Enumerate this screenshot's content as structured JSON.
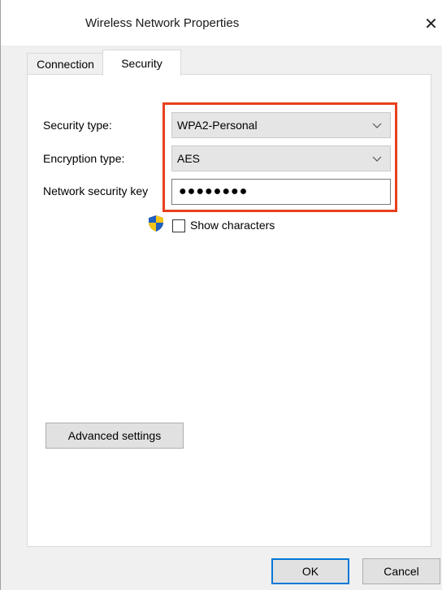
{
  "window": {
    "title": "Wireless Network Properties",
    "close_glyph": "✕"
  },
  "tabs": [
    {
      "label": "Connection",
      "selected": false
    },
    {
      "label": "Security",
      "selected": true
    }
  ],
  "security": {
    "security_type_label": "Security type:",
    "security_type_value": "WPA2-Personal",
    "encryption_type_label": "Encryption type:",
    "encryption_type_value": "AES",
    "key_label": "Network security key",
    "key_value": "●●●●●●●●",
    "show_characters_label": "Show characters",
    "show_characters_checked": false
  },
  "buttons": {
    "advanced": "Advanced settings",
    "ok": "OK",
    "cancel": "Cancel"
  },
  "colors": {
    "highlight": "#e8401c",
    "ok_border": "#0078d7"
  },
  "icons": {
    "close": "close-icon",
    "dropdown": "chevron-down-icon",
    "uac": "uac-shield-icon"
  }
}
